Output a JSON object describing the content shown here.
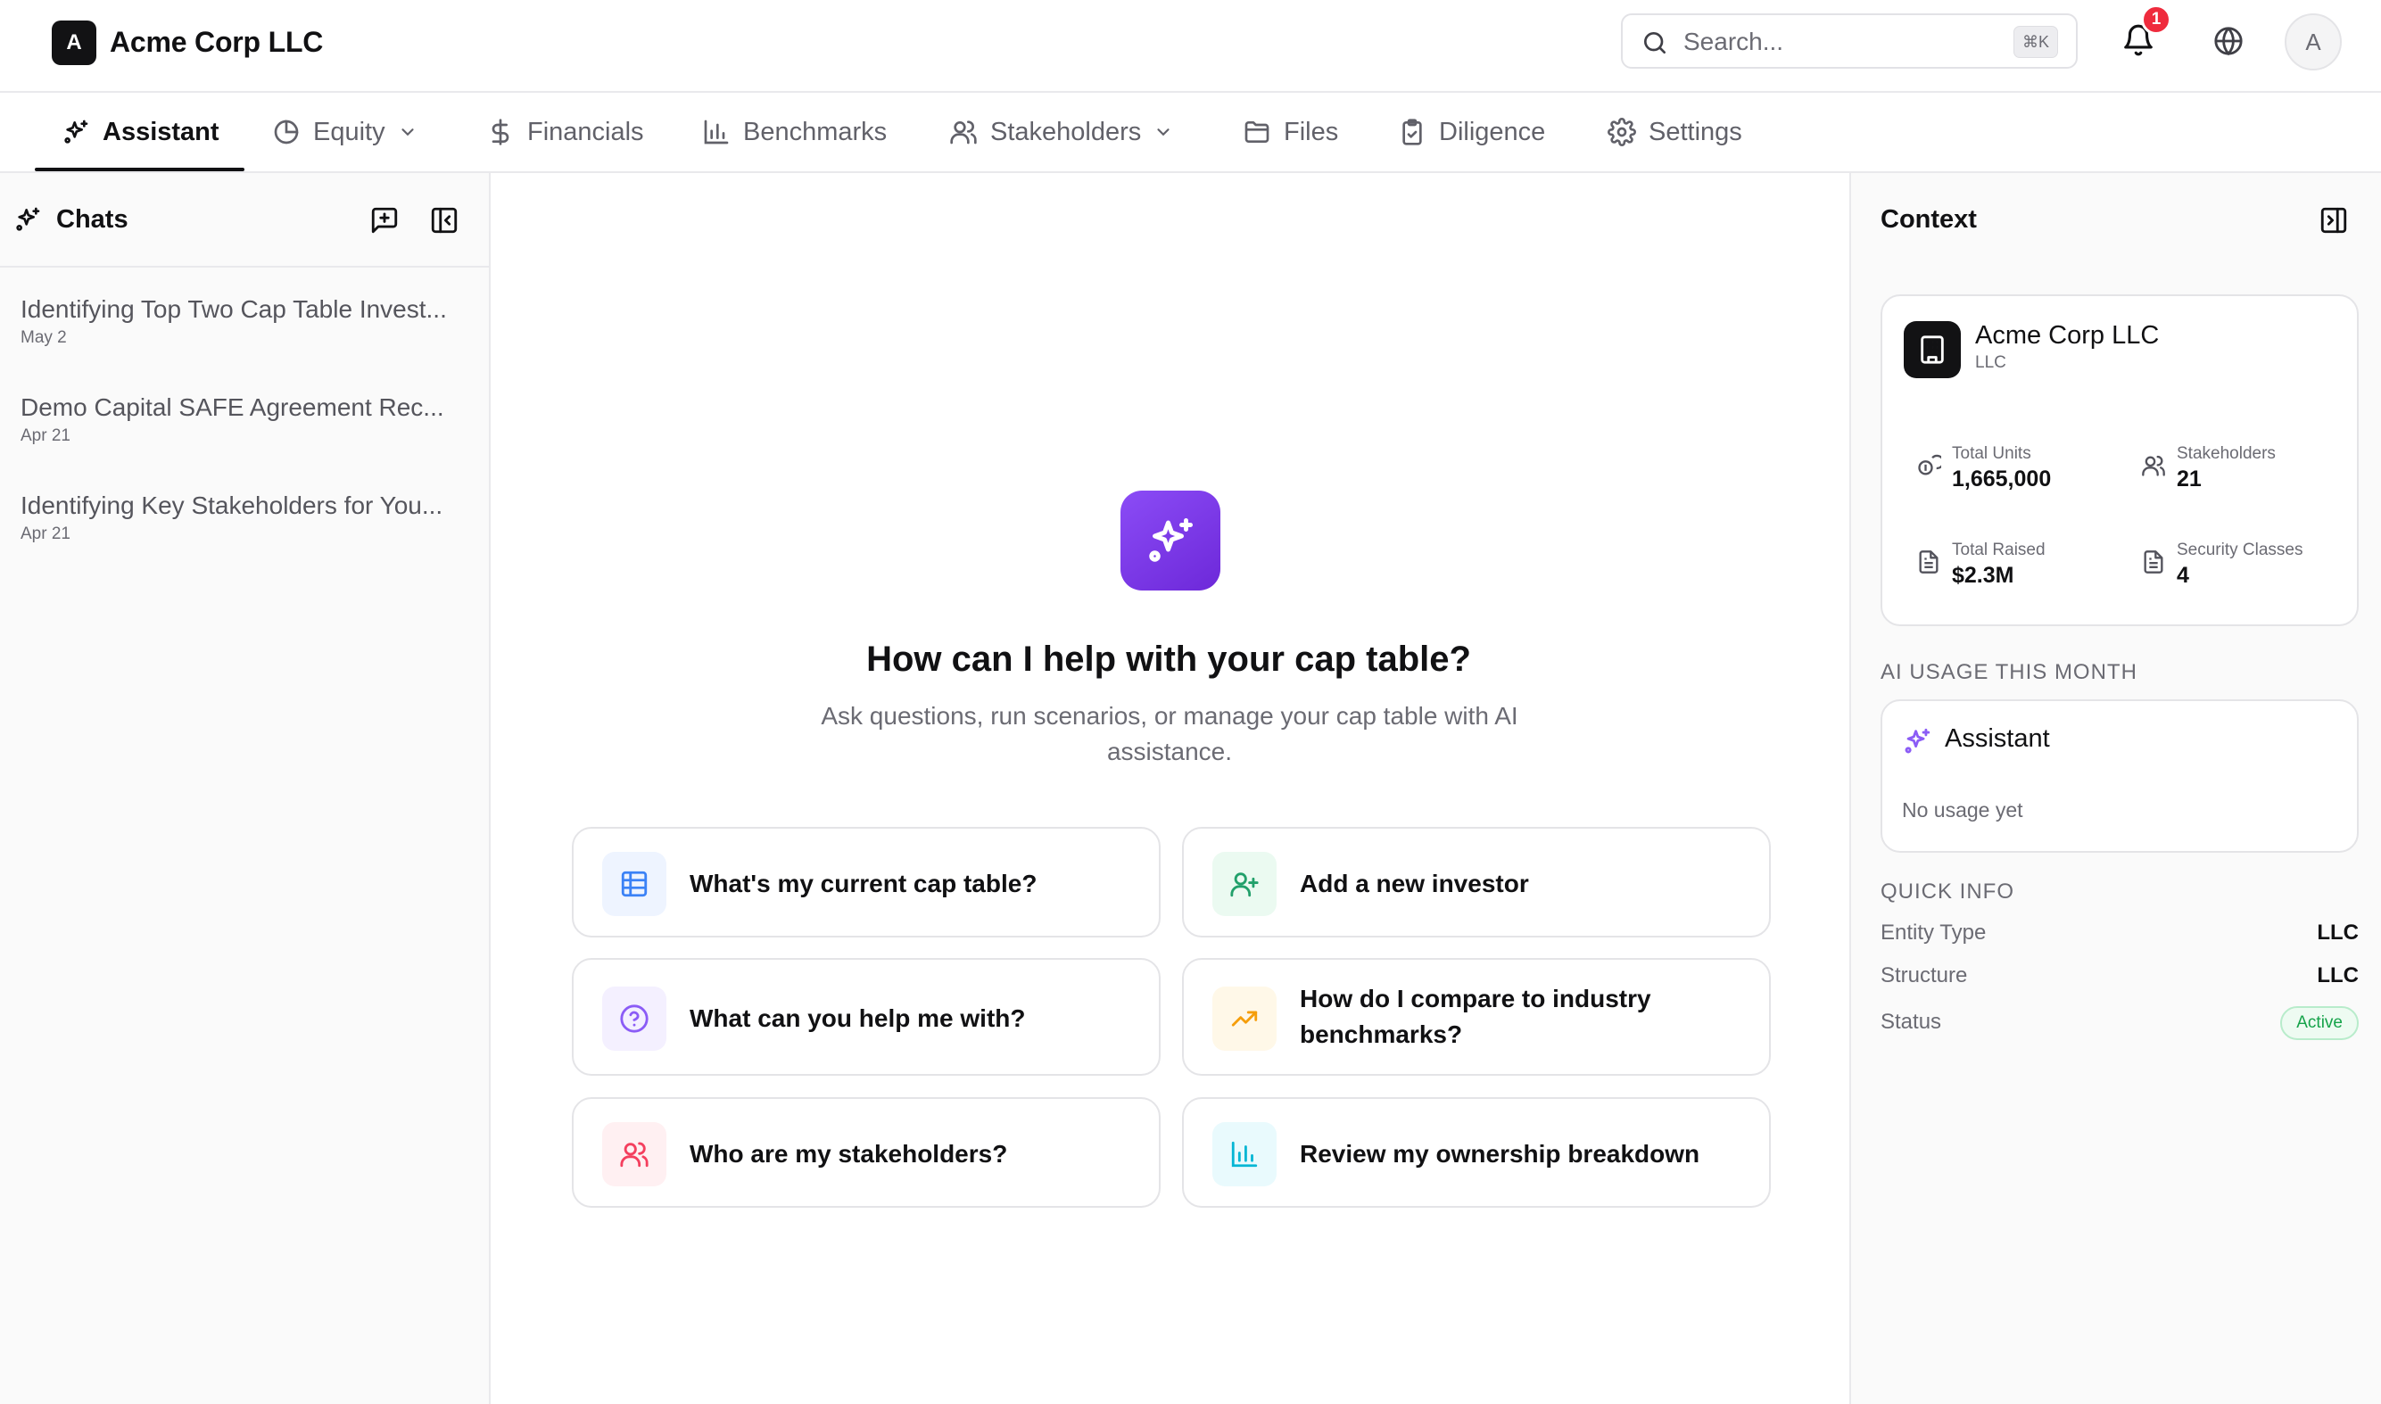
{
  "header": {
    "logo_letter": "A",
    "company": "Acme Corp LLC",
    "search_placeholder": "Search...",
    "search_shortcut": "⌘K",
    "notification_count": "1",
    "avatar_letter": "A"
  },
  "tabs": [
    {
      "label": "Assistant",
      "icon": "sparkles-icon",
      "active": true
    },
    {
      "label": "Equity",
      "icon": "pie-chart-icon",
      "has_dropdown": true
    },
    {
      "label": "Financials",
      "icon": "dollar-icon"
    },
    {
      "label": "Benchmarks",
      "icon": "bar-chart-icon"
    },
    {
      "label": "Stakeholders",
      "icon": "users-icon",
      "has_dropdown": true
    },
    {
      "label": "Files",
      "icon": "folder-icon"
    },
    {
      "label": "Diligence",
      "icon": "clipboard-check-icon"
    },
    {
      "label": "Settings",
      "icon": "gear-icon"
    }
  ],
  "sidebar": {
    "title": "Chats",
    "chats": [
      {
        "title": "Identifying Top Two Cap Table Invest...",
        "date": "May 2"
      },
      {
        "title": "Demo Capital SAFE Agreement Rec...",
        "date": "Apr 21"
      },
      {
        "title": "Identifying Key Stakeholders for You...",
        "date": "Apr 21"
      }
    ]
  },
  "main": {
    "title": "How can I help with your cap table?",
    "subtitle": "Ask questions, run scenarios, or manage your cap table with AI assistance.",
    "suggestions": [
      {
        "label": "What's my current cap table?",
        "icon": "table-icon",
        "color": "#3b82f6",
        "bg": "#eef4ff"
      },
      {
        "label": "Add a new investor",
        "icon": "user-plus-icon",
        "color": "#22a06b",
        "bg": "#ebfaf1"
      },
      {
        "label": "What can you help me with?",
        "icon": "help-circle-icon",
        "color": "#8b5cf6",
        "bg": "#f4f0ff"
      },
      {
        "label": "How do I compare to industry benchmarks?",
        "icon": "trending-up-icon",
        "color": "#f59e0b",
        "bg": "#fff8e8"
      },
      {
        "label": "Who are my stakeholders?",
        "icon": "users-icon",
        "color": "#f43f5e",
        "bg": "#fff0f2"
      },
      {
        "label": "Review my ownership breakdown",
        "icon": "bar-chart-icon",
        "color": "#06b6d4",
        "bg": "#e9fafd"
      }
    ]
  },
  "context": {
    "title": "Context",
    "company": {
      "name": "Acme Corp LLC",
      "type": "LLC"
    },
    "stats": [
      {
        "label": "Total Units",
        "value": "1,665,000",
        "icon": "coins-icon"
      },
      {
        "label": "Stakeholders",
        "value": "21",
        "icon": "users-icon"
      },
      {
        "label": "Total Raised",
        "value": "$2.3M",
        "icon": "document-icon"
      },
      {
        "label": "Security Classes",
        "value": "4",
        "icon": "document-icon"
      }
    ],
    "ai_usage": {
      "section_label": "AI USAGE THIS MONTH",
      "name": "Assistant",
      "usage": "No usage yet"
    },
    "quick_info": {
      "section_label": "QUICK INFO",
      "rows": [
        {
          "key": "Entity Type",
          "value": "LLC"
        },
        {
          "key": "Structure",
          "value": "LLC"
        },
        {
          "key": "Status",
          "value": "Active"
        }
      ]
    }
  }
}
